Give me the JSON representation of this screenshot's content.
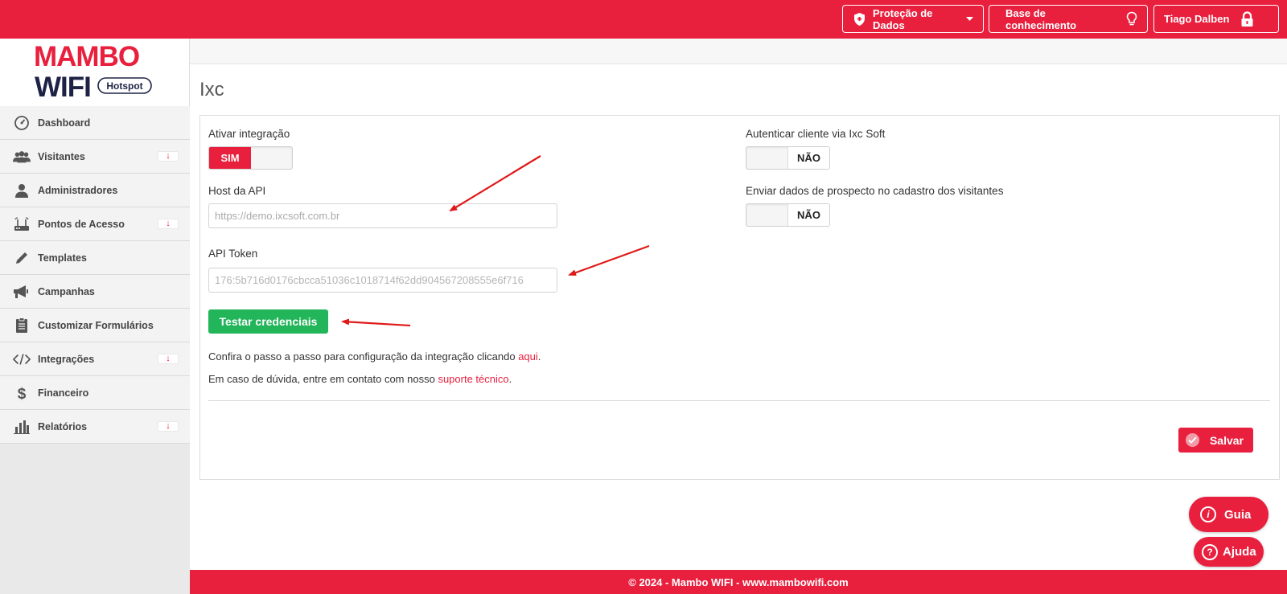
{
  "header": {
    "data_protection": "Proteção de Dados",
    "knowledge_base": "Base de conhecimento",
    "user_name": "Tiago Dalben"
  },
  "logo": {
    "line1": "MAMBO",
    "line2": "WIFI",
    "badge": "Hotspot"
  },
  "sidebar": {
    "items": [
      {
        "label": "Dashboard",
        "icon": "dashboard-gauge-icon",
        "badge": ""
      },
      {
        "label": "Visitantes",
        "icon": "users-icon",
        "badge": "↓"
      },
      {
        "label": "Administradores",
        "icon": "user-icon",
        "badge": ""
      },
      {
        "label": "Pontos de Acesso",
        "icon": "router-icon",
        "badge": "↓"
      },
      {
        "label": "Templates",
        "icon": "pencil-icon",
        "badge": ""
      },
      {
        "label": "Campanhas",
        "icon": "megaphone-icon",
        "badge": ""
      },
      {
        "label": "Customizar Formulários",
        "icon": "clipboard-icon",
        "badge": ""
      },
      {
        "label": "Integrações",
        "icon": "code-icon",
        "badge": "↓"
      },
      {
        "label": "Financeiro",
        "icon": "dollar-icon",
        "badge": ""
      },
      {
        "label": "Relatórios",
        "icon": "bar-chart-icon",
        "badge": "↓"
      }
    ]
  },
  "page": {
    "title": "Ixc"
  },
  "form": {
    "enable_integration": {
      "label": "Ativar integração",
      "on": "SIM",
      "value": true
    },
    "api_host": {
      "label": "Host da API",
      "placeholder": "https://demo.ixcsoft.com.br",
      "value": ""
    },
    "api_token": {
      "label": "API Token",
      "value": "176:5b716d0176cbcca51036c1018714f62dd904567208555e6f716"
    },
    "authenticate_client": {
      "label": "Autenticar cliente via Ixc Soft",
      "off": "NÃO",
      "value": false
    },
    "send_prospect": {
      "label": "Enviar dados de prospecto no cadastro dos visitantes",
      "off": "NÃO",
      "value": false
    },
    "test_button": "Testar credenciais",
    "info1_text": "Confira o passo a passo para configuração da integração clicando ",
    "info1_link": "aqui",
    "info1_end": ".",
    "info2_text": "Em caso de dúvida, entre em contato com nosso ",
    "info2_link": "suporte técnico",
    "info2_end": ".",
    "save_button": "Salvar"
  },
  "floating": {
    "guide": "Guia",
    "help": "Ajuda"
  },
  "footer": {
    "text": "© 2024 - Mambo WIFI - www.mambowifi.com"
  },
  "colors": {
    "brand": "#e8203e",
    "success": "#22b55a"
  }
}
